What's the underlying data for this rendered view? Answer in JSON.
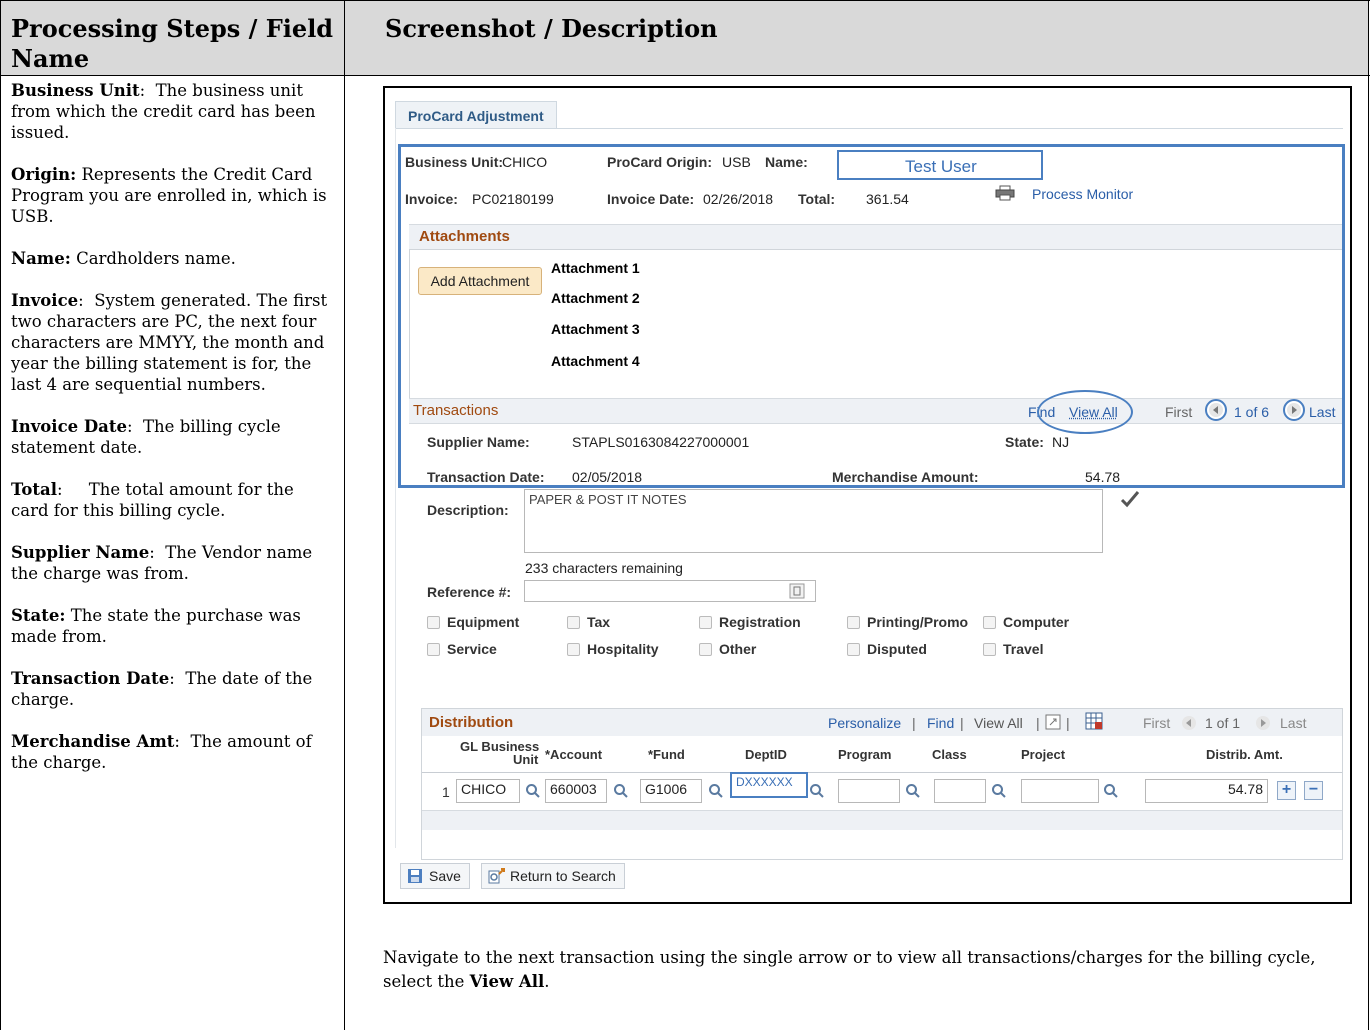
{
  "doc": {
    "col1_header": "Processing Steps / Field Name",
    "col2_header": "Screenshot / Description",
    "left_items": [
      {
        "term": "Business Unit",
        "sep": ":  ",
        "text": "The business unit from which the credit card has been issued."
      },
      {
        "term": "Origin:",
        "sep": " ",
        "text": "Represents the Credit Card Program you are enrolled in, which is USB."
      },
      {
        "term": "Name:",
        "sep": " ",
        "text": "Cardholders name."
      },
      {
        "term": "Invoice",
        "sep": ":  ",
        "text": "System generated.  The first two characters are PC, the next four characters are MMYY, the month and year the billing statement is for, the last 4 are sequential numbers."
      },
      {
        "term": "Invoice Date",
        "sep": ":  ",
        "text": "The billing cycle statement date."
      },
      {
        "term": "Total",
        "sep": ":     ",
        "text": "The total amount for the card for this billing cycle."
      },
      {
        "term": "Supplier Name",
        "sep": ":  ",
        "text": "The Vendor name the charge was from."
      },
      {
        "term": "State:",
        "sep": " ",
        "text": "The state the purchase was made from."
      },
      {
        "term": "Transaction Date",
        "sep": ":  ",
        "text": "The date of the charge."
      },
      {
        "term": "Merchandise Amt",
        "sep": ":  ",
        "text": "The amount of the charge."
      }
    ],
    "instruction_pre": "Navigate to the next transaction using the single arrow or to view all transactions/charges for the billing cycle, select the ",
    "instruction_bold": "View All",
    "instruction_post": "."
  },
  "app": {
    "tab": "ProCard Adjustment",
    "header": {
      "business_unit_label": "Business Unit:",
      "business_unit_value": "CHICO",
      "origin_label": "ProCard Origin:",
      "origin_value": "USB",
      "name_label": "Name:",
      "name_value": "Test User",
      "invoice_label": "Invoice:",
      "invoice_value": "PC02180199",
      "invoice_date_label": "Invoice Date:",
      "invoice_date_value": "02/26/2018",
      "total_label": "Total:",
      "total_value": "361.54",
      "process_monitor": "Process Monitor"
    },
    "attachments": {
      "title": "Attachments",
      "add_button": "Add Attachment",
      "items": [
        "Attachment 1",
        "Attachment 2",
        "Attachment 3",
        "Attachment 4"
      ]
    },
    "transactions": {
      "title": "Transactions",
      "find": "Find",
      "view_all": "View All",
      "first": "First",
      "counter": "1 of 6",
      "last": "Last",
      "supplier_label": "Supplier Name:",
      "supplier_value": "STAPLS0163084227000001",
      "state_label": "State:",
      "state_value": "NJ",
      "tdate_label": "Transaction Date:",
      "tdate_value": "02/05/2018",
      "merch_label": "Merchandise Amount:",
      "merch_value": "54.78",
      "desc_label": "Description:",
      "desc_value": "PAPER & POST IT NOTES",
      "chars_remaining": "233 characters remaining",
      "ref_label": "Reference #:"
    },
    "checkboxes": [
      [
        "Equipment",
        "Tax",
        "Registration",
        "Printing/Promo",
        "Computer"
      ],
      [
        "Service",
        "Hospitality",
        "Other",
        "Disputed",
        "Travel"
      ]
    ],
    "distribution": {
      "title": "Distribution",
      "personalize": "Personalize",
      "find": "Find",
      "view_all": "View All",
      "sep": "|",
      "first": "First",
      "counter": "1 of 1",
      "last": "Last",
      "columns": {
        "gl_bu_line1": "GL Business",
        "gl_bu_line2": "Unit",
        "account": "*Account",
        "fund": "*Fund",
        "dept": "DeptID",
        "program": "Program",
        "class": "Class",
        "project": "Project",
        "amount": "Distrib. Amt."
      },
      "row": {
        "num": "1",
        "bu": "CHICO",
        "account": "660003",
        "fund": "G1006",
        "dept": "DXXXXXX",
        "program": "",
        "class": "",
        "project": "",
        "amount": "54.78"
      }
    },
    "footer": {
      "save": "Save",
      "return": "Return to Search"
    }
  }
}
